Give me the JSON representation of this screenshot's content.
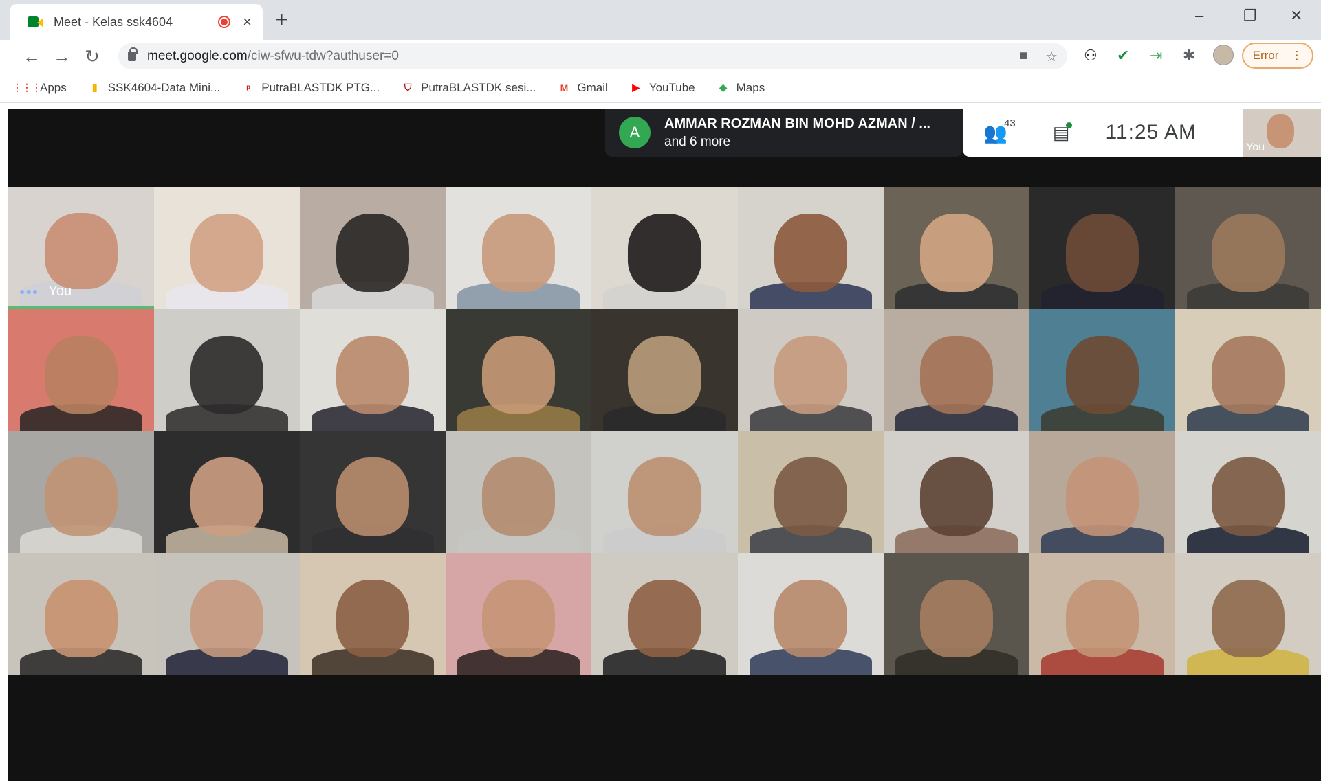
{
  "browser": {
    "tab": {
      "title": "Meet - Kelas ssk4604",
      "close": "×"
    },
    "new_tab": "+",
    "window": {
      "minimize": "–",
      "restore": "❐",
      "close": "✕"
    },
    "nav": {
      "back": "←",
      "forward": "→",
      "reload": "↻"
    },
    "url": {
      "host": "meet.google.com",
      "path": "/ciw-sfwu-tdw?authuser=0"
    },
    "omnibox_icons": {
      "camera": "■",
      "star": "☆"
    },
    "extensions": {
      "ext1": "⚇",
      "ext2": "✔",
      "ext3": "⇥",
      "puzzle": "✱"
    },
    "error_button": {
      "label": "Error",
      "menu": "⋮"
    },
    "bookmarks": [
      {
        "label": "Apps",
        "icon": "⋮⋮⋮",
        "color": "#ea4335"
      },
      {
        "label": "SSK4604-Data Mini...",
        "icon": "▮",
        "color": "#f4b400"
      },
      {
        "label": "PutraBLASTDK PTG...",
        "icon": "ᵖ",
        "color": "#c5221f"
      },
      {
        "label": "PutraBLASTDK sesi...",
        "icon": "⛉",
        "color": "#a50e0e"
      },
      {
        "label": "Gmail",
        "icon": "M",
        "color": "#ea4335"
      },
      {
        "label": "YouTube",
        "icon": "▶",
        "color": "#ff0000"
      },
      {
        "label": "Maps",
        "icon": "◆",
        "color": "#34a853"
      }
    ]
  },
  "meet": {
    "presenter": {
      "initial": "A",
      "name": "AMMAR ROZMAN BIN MOHD AZMAN / ...",
      "more": "and 6 more"
    },
    "participants_count": "43",
    "time": "11:25  AM",
    "self_view_label": "You",
    "tiles": [
      {
        "bg": "#d9d3cf",
        "face": "#c98e73",
        "body": "#cfcfd6",
        "label": "You"
      },
      {
        "bg": "#e8e2d8",
        "face": "#d2a285",
        "body": "#e9e6ef"
      },
      {
        "bg": "#b8aca3",
        "face": "#2a2726",
        "body": "#d8d8d8"
      },
      {
        "bg": "#e2e1dd",
        "face": "#c99a7c",
        "body": "#8494a6"
      },
      {
        "bg": "#ddd8d0",
        "face": "#1f1c1b",
        "body": "#d4d2d0"
      },
      {
        "bg": "#d6d2cc",
        "face": "#8c5a3e",
        "body": "#2b3552"
      },
      {
        "bg": "#6b6355",
        "face": "#d1a584",
        "body": "#2e2e33"
      },
      {
        "bg": "#2a2a2a",
        "face": "#6e4a37",
        "body": "#222230"
      },
      {
        "bg": "#5e5850",
        "face": "#9c7a5c",
        "body": "#3b3a36"
      },
      {
        "bg": "#d97a6e",
        "face": "#b8805f",
        "body": "#262626"
      },
      {
        "bg": "#cfcdc8",
        "face": "#2c2a2a",
        "body": "#2c2a2a"
      },
      {
        "bg": "#e0ded8",
        "face": "#b98a6c",
        "body": "#23232e"
      },
      {
        "bg": "#3a3a34",
        "face": "#c79a75",
        "body": "#9a7e46"
      },
      {
        "bg": "#3a342e",
        "face": "#b99c7a",
        "body": "#2a2a2a"
      },
      {
        "bg": "#cfcac4",
        "face": "#c59a7e",
        "body": "#3a3a3e"
      },
      {
        "bg": "#b9aca1",
        "face": "#a47358",
        "body": "#25293b"
      },
      {
        "bg": "#4f7f92",
        "face": "#6d4a34",
        "body": "#3b3b2f"
      },
      {
        "bg": "#d7cdb8",
        "face": "#a67a5e",
        "body": "#2e3b4d"
      },
      {
        "bg": "#a9a7a4",
        "face": "#c09373",
        "body": "#dcd9d4"
      },
      {
        "bg": "#2d2d2d",
        "face": "#cc9f82",
        "body": "#c9b8a5"
      },
      {
        "bg": "#353535",
        "face": "#b88c6d",
        "body": "#2f2f33"
      },
      {
        "bg": "#c4c3be",
        "face": "#b48c6f",
        "body": "#c6c5c3"
      },
      {
        "bg": "#d0d0cd",
        "face": "#bb8f71",
        "body": "#cbcbcb"
      },
      {
        "bg": "#c9bfa8",
        "face": "#7b5a44",
        "body": "#3a3d47"
      },
      {
        "bg": "#d3d0cb",
        "face": "#5c4333",
        "body": "#8a6b5c"
      },
      {
        "bg": "#b7a89a",
        "face": "#c49478",
        "body": "#2f3d55"
      },
      {
        "bg": "#d6d4cf",
        "face": "#7c5a43",
        "body": "#141b2c"
      },
      {
        "bg": "#c8c3bb",
        "face": "#c79271",
        "body": "#262626"
      },
      {
        "bg": "#c6c2bc",
        "face": "#c69a7e",
        "body": "#1f2238"
      },
      {
        "bg": "#d5c7b2",
        "face": "#8a5f45",
        "body": "#3a2e24"
      },
      {
        "bg": "#d6a6a6",
        "face": "#c59577",
        "body": "#2a1e1e"
      },
      {
        "bg": "#cfcbc3",
        "face": "#8e6245",
        "body": "#1d1d1f"
      },
      {
        "bg": "#dcdbd7",
        "face": "#b7896b",
        "body": "#2e3b58"
      },
      {
        "bg": "#5b564d",
        "face": "#a57d5f",
        "body": "#302b27"
      },
      {
        "bg": "#c9b9a6",
        "face": "#c39577",
        "body": "#a7372d"
      },
      {
        "bg": "#d2ccc3",
        "face": "#8e6a4f",
        "body": "#d1b33f"
      }
    ]
  }
}
